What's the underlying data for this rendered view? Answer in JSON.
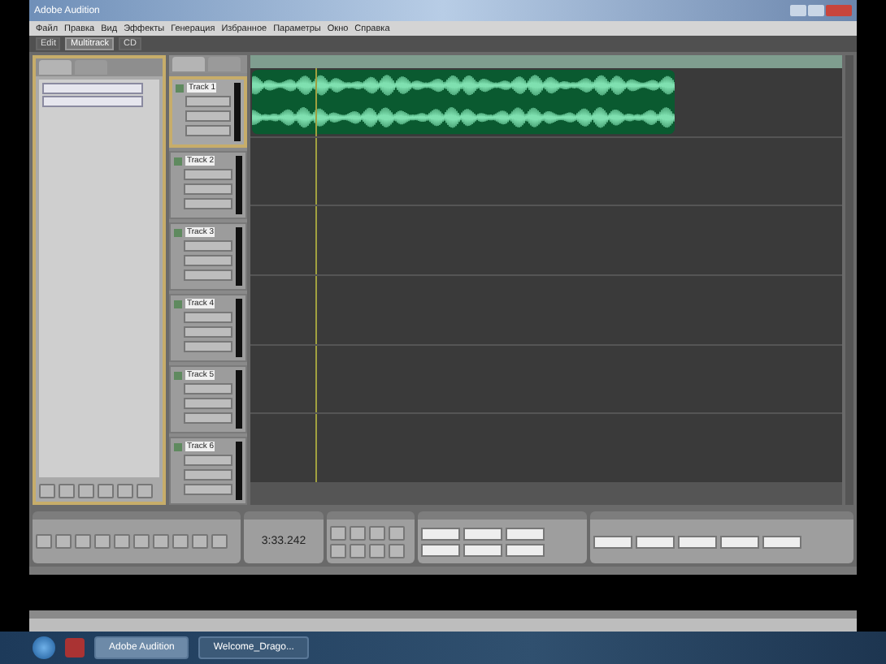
{
  "window": {
    "title": "Adobe Audition"
  },
  "menu": [
    "Файл",
    "Правка",
    "Вид",
    "Эффекты",
    "Генерация",
    "Избранное",
    "Параметры",
    "Окно",
    "Справка"
  ],
  "workspace_tabs": [
    {
      "label": "Edit",
      "selected": false
    },
    {
      "label": "Multitrack",
      "selected": true
    },
    {
      "label": "CD",
      "selected": false
    }
  ],
  "tracks": [
    {
      "name": "Track 1",
      "selected": true,
      "clip": true
    },
    {
      "name": "Track 2",
      "selected": false,
      "clip": false
    },
    {
      "name": "Track 3",
      "selected": false,
      "clip": false
    },
    {
      "name": "Track 4",
      "selected": false,
      "clip": false
    },
    {
      "name": "Track 5",
      "selected": false,
      "clip": false
    },
    {
      "name": "Track 6",
      "selected": false,
      "clip": false
    }
  ],
  "time": {
    "display": "3:33.242"
  },
  "taskbar": {
    "items": [
      {
        "label": "Adobe Audition",
        "selected": true
      },
      {
        "label": "Welcome_Drago...",
        "selected": false
      }
    ]
  }
}
